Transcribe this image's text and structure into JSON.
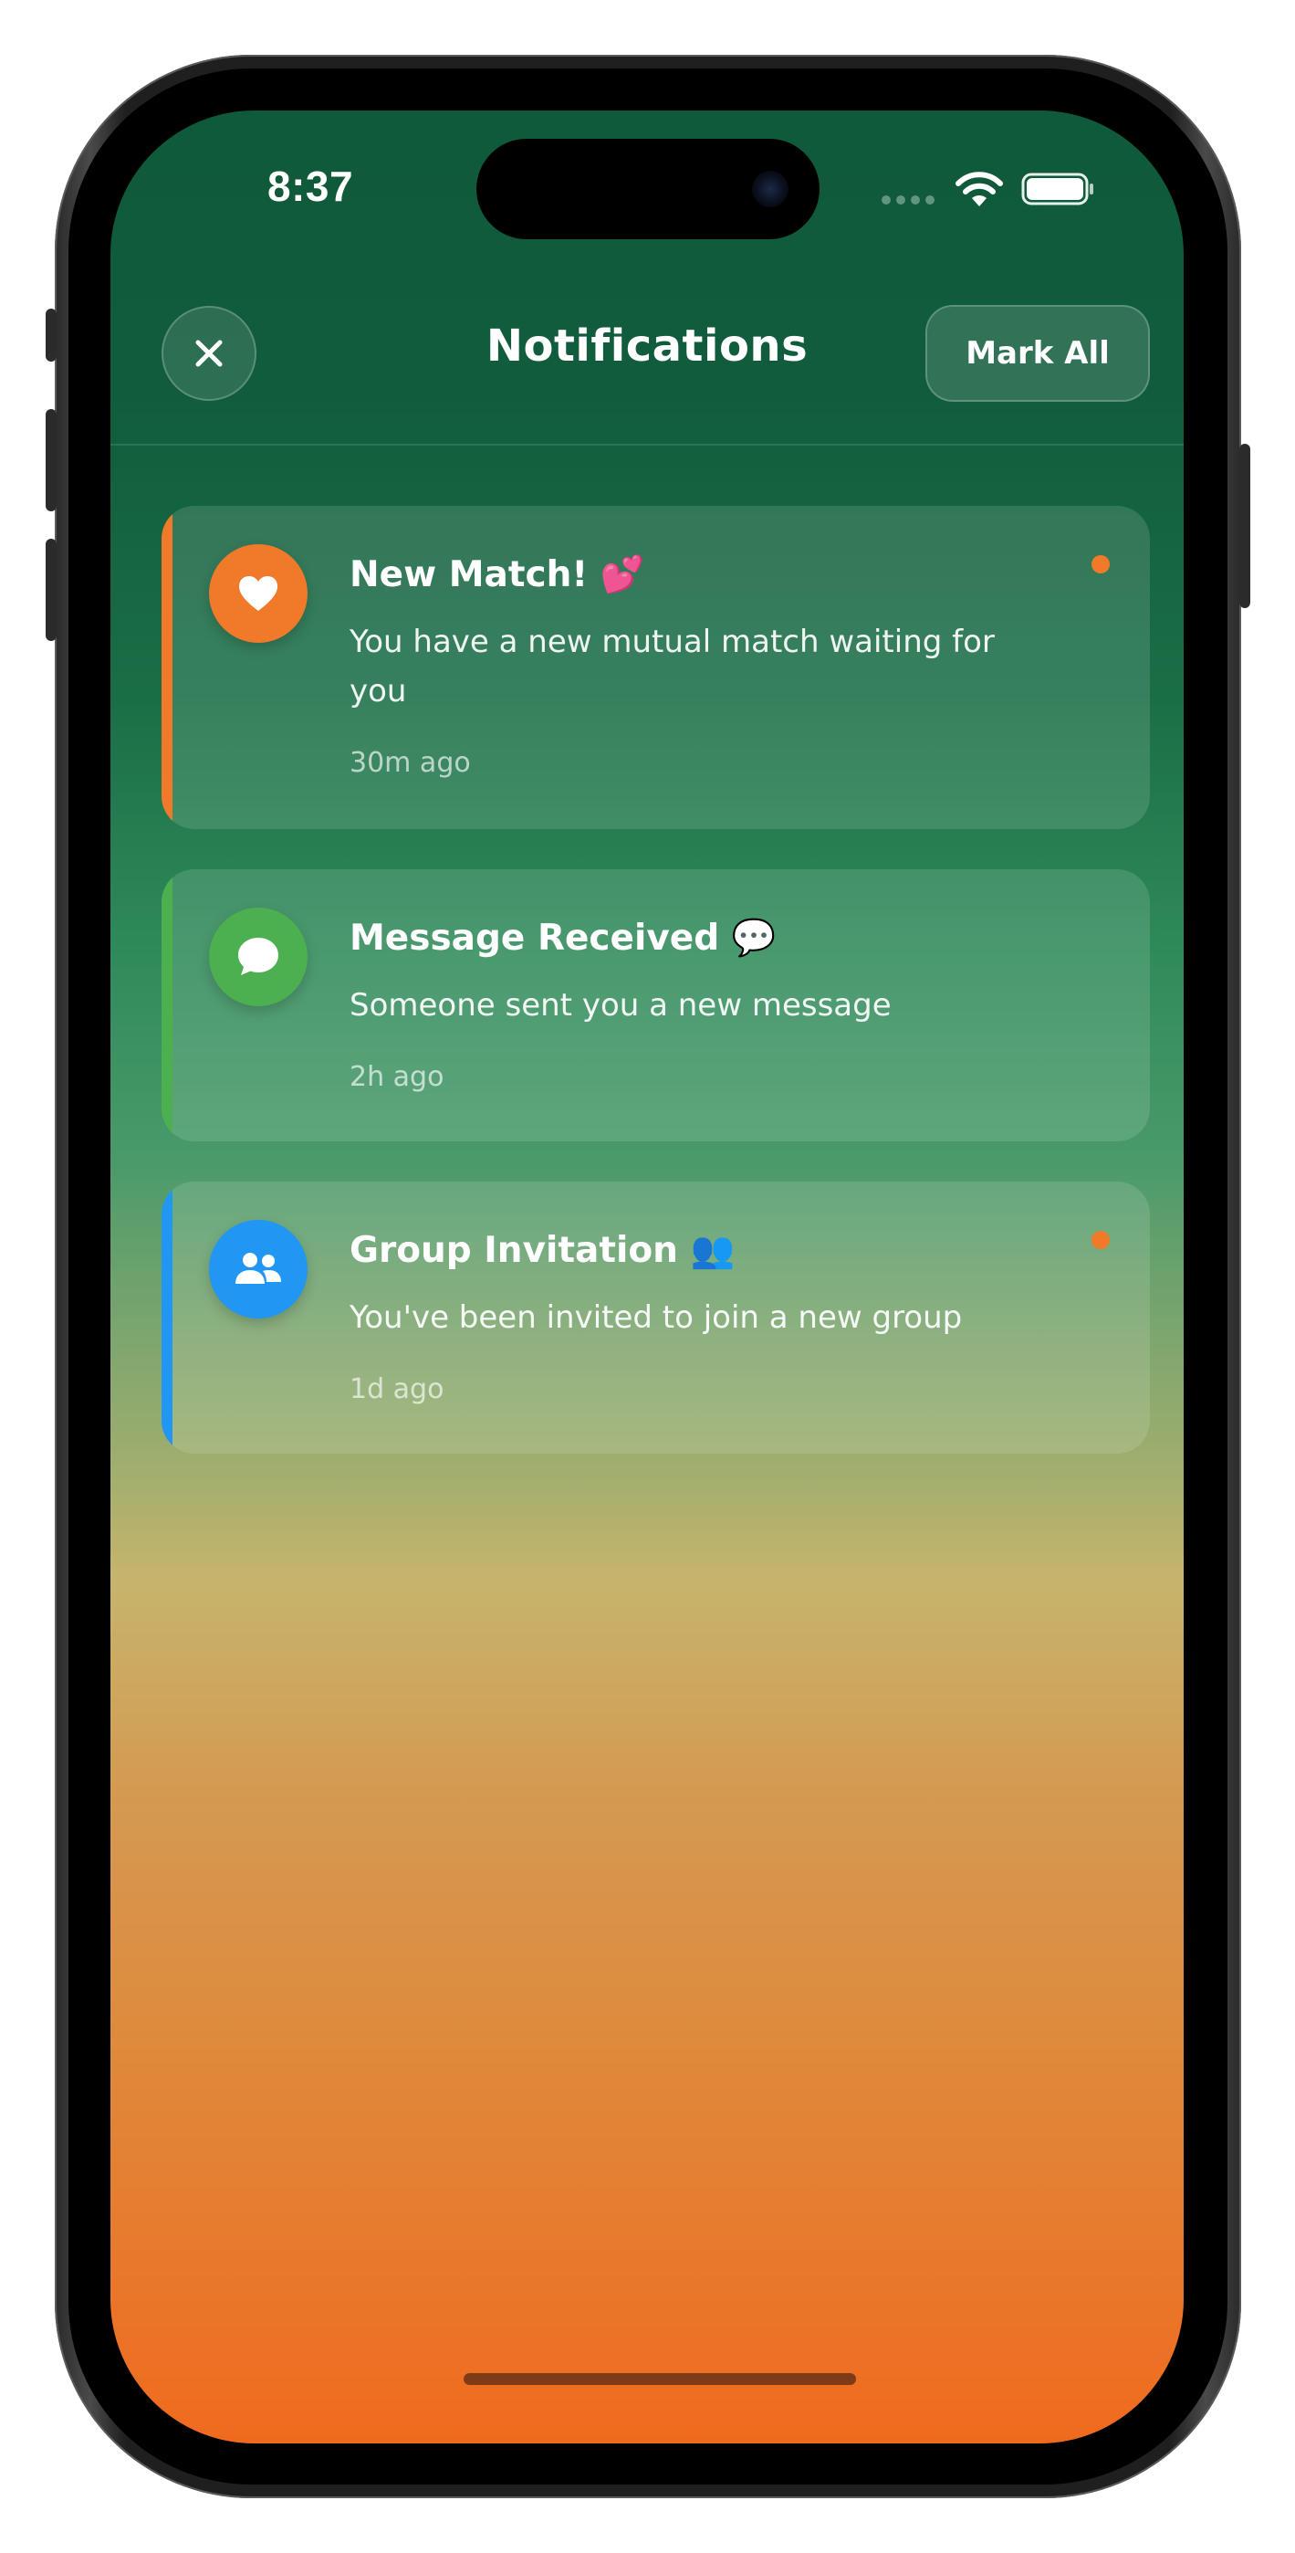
{
  "status_bar": {
    "time": "8:37"
  },
  "header": {
    "title": "Notifications",
    "mark_all_label": "Mark All",
    "close_icon": "close-icon"
  },
  "notifications": [
    {
      "title": "New Match! 💕",
      "body": "You have a new mutual match waiting for you",
      "time": "30m ago",
      "icon": "heart-icon",
      "accent_color": "#f07a2a",
      "icon_bg": "#f07a2a",
      "unread": true
    },
    {
      "title": "Message Received 💬",
      "body": "Someone sent you a new message",
      "time": "2h ago",
      "icon": "chat-bubble-icon",
      "accent_color": "#4caf50",
      "icon_bg": "#4caf50",
      "unread": false
    },
    {
      "title": "Group Invitation 👥",
      "body": "You've been invited to join a new group",
      "time": "1d ago",
      "icon": "group-icon",
      "accent_color": "#2196f3",
      "icon_bg": "#2196f3",
      "unread": true
    }
  ],
  "colors": {
    "background_top": "#0f5a3a",
    "background_bottom": "#f06a1e",
    "unread_dot": "#f07a2a"
  }
}
